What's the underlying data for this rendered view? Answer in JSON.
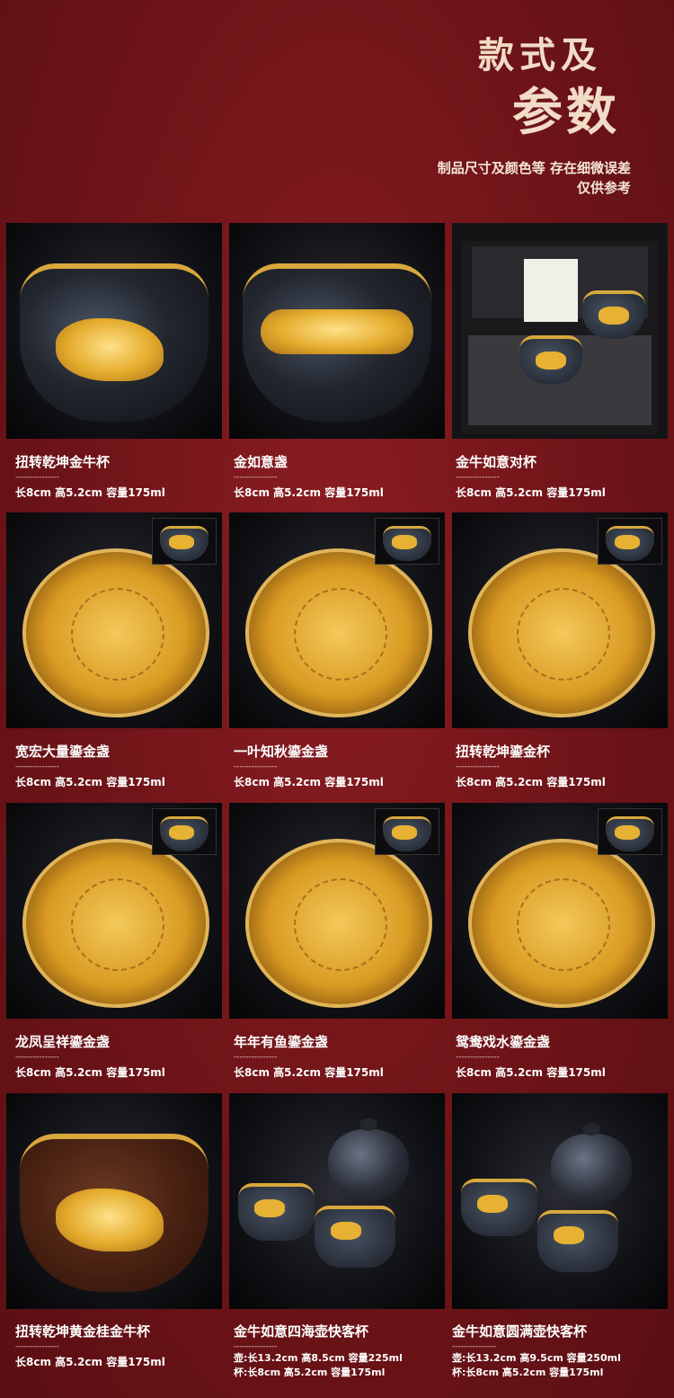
{
  "header": {
    "title_line1": "款式及",
    "title_line2": "参数",
    "note_line1": "制品尺寸及颜色等 存在细微误差",
    "note_line2": "仅供参考"
  },
  "dash": "---------------",
  "products": [
    {
      "name": "扭转乾坤金牛杯",
      "spec": "长8cm 高5.2cm 容量175ml"
    },
    {
      "name": "金如意盏",
      "spec": "长8cm 高5.2cm 容量175ml"
    },
    {
      "name": "金牛如意对杯",
      "spec": "长8cm 高5.2cm 容量175ml"
    },
    {
      "name": "宽宏大量鎏金盏",
      "spec": "长8cm 高5.2cm 容量175ml"
    },
    {
      "name": "一叶知秋鎏金盏",
      "spec": "长8cm 高5.2cm 容量175ml"
    },
    {
      "name": "扭转乾坤鎏金杯",
      "spec": "长8cm 高5.2cm 容量175ml"
    },
    {
      "name": "龙凤呈祥鎏金盏",
      "spec": "长8cm 高5.2cm 容量175ml"
    },
    {
      "name": "年年有鱼鎏金盏",
      "spec": "长8cm 高5.2cm 容量175ml"
    },
    {
      "name": "鸳鸯戏水鎏金盏",
      "spec": "长8cm 高5.2cm 容量175ml"
    },
    {
      "name": "扭转乾坤黄金桂金牛杯",
      "spec": "长8cm 高5.2cm 容量175ml"
    },
    {
      "name": "金牛如意四海壶快客杯",
      "spec_line1": "壶:长13.2cm 高8.5cm 容量225ml",
      "spec_line2": "杯:长8cm 高5.2cm 容量175ml"
    },
    {
      "name": "金牛如意圆满壶快客杯",
      "spec_line1": "壶:长13.2cm 高9.5cm 容量250ml",
      "spec_line2": "杯:长8cm 高5.2cm 容量175ml"
    }
  ]
}
